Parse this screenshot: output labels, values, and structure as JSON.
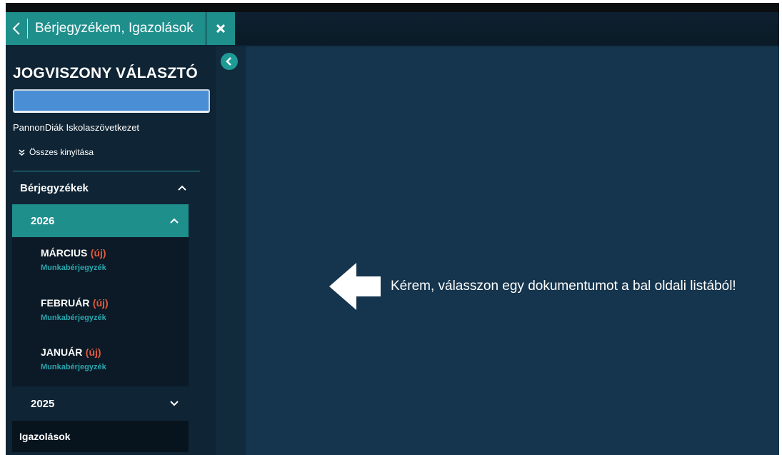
{
  "tab": {
    "title": "Bérjegyzékem, Igazolások",
    "back_icon": "chevron-left-icon",
    "close_icon": "close-icon"
  },
  "sidebar": {
    "title": "JOGVISZONY VÁLASZTÓ",
    "selected_value": "",
    "company": "PannonDiák Iskolaszövetkezet",
    "expand_all": "Összes kinyitása",
    "sections": {
      "berjegyzekek": "Bérjegyzékek",
      "igazolasok": "Igazolások"
    },
    "years": [
      {
        "label": "2026",
        "expanded": true,
        "months": [
          {
            "name": "MÁRCIUS",
            "badge": "(új)",
            "sub": "Munkabérjegyzék"
          },
          {
            "name": "FEBRUÁR",
            "badge": "(új)",
            "sub": "Munkabérjegyzék"
          },
          {
            "name": "JANUÁR",
            "badge": "(új)",
            "sub": "Munkabérjegyzék"
          }
        ]
      },
      {
        "label": "2025",
        "expanded": false
      }
    ]
  },
  "main": {
    "hint": "Kérem, válasszon egy dokumentumot a bal oldali listából!"
  },
  "colors": {
    "accent": "#1f8f8c",
    "new_badge": "#e55a3c",
    "sub_text": "#2aa6ad",
    "main_bg": "#15344d"
  }
}
